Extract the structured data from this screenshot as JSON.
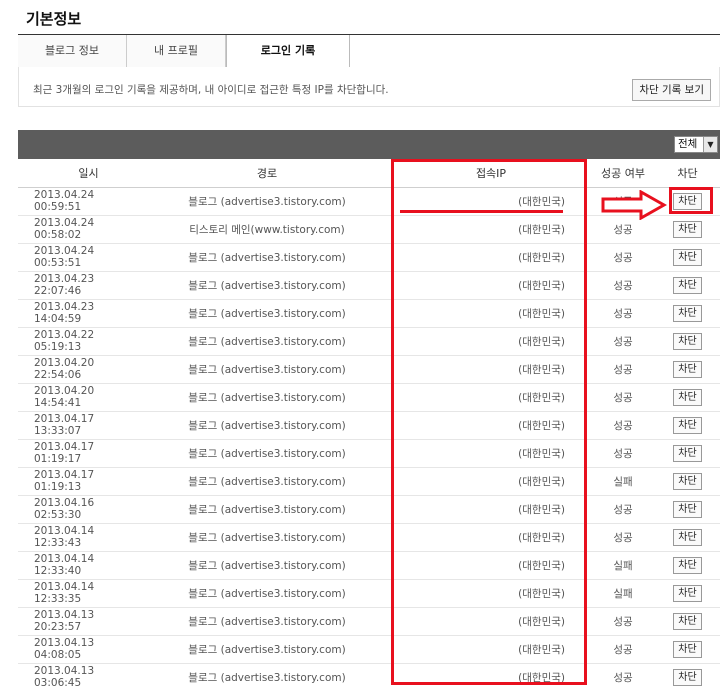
{
  "page": {
    "title": "기본정보"
  },
  "tabs": [
    {
      "label": "블로그 정보"
    },
    {
      "label": "내 프로필"
    },
    {
      "label": "로그인 기록"
    }
  ],
  "info": {
    "text": "최근 3개월의 로그인 기록을 제공하며, 내 아이디로 접근한 특정 IP를 차단합니다.",
    "block_history_button": "차단 기록 보기"
  },
  "filter": {
    "selected": "전체"
  },
  "table": {
    "headers": {
      "date": "일시",
      "path": "경로",
      "ip": "접속IP",
      "result": "성공 여부",
      "block": "차단"
    },
    "rows": [
      {
        "date": "2013.04.24 00:59:51",
        "path": "블로그 (advertise3.tistory.com)",
        "ip": "(대한민국)",
        "result": "성공",
        "block": "차단"
      },
      {
        "date": "2013.04.24 00:58:02",
        "path": "티스토리 메인(www.tistory.com)",
        "ip": "(대한민국)",
        "result": "성공",
        "block": "차단"
      },
      {
        "date": "2013.04.24 00:53:51",
        "path": "블로그 (advertise3.tistory.com)",
        "ip": "(대한민국)",
        "result": "성공",
        "block": "차단"
      },
      {
        "date": "2013.04.23 22:07:46",
        "path": "블로그 (advertise3.tistory.com)",
        "ip": "(대한민국)",
        "result": "성공",
        "block": "차단"
      },
      {
        "date": "2013.04.23 14:04:59",
        "path": "블로그 (advertise3.tistory.com)",
        "ip": "(대한민국)",
        "result": "성공",
        "block": "차단"
      },
      {
        "date": "2013.04.22 05:19:13",
        "path": "블로그 (advertise3.tistory.com)",
        "ip": "(대한민국)",
        "result": "성공",
        "block": "차단"
      },
      {
        "date": "2013.04.20 22:54:06",
        "path": "블로그 (advertise3.tistory.com)",
        "ip": "(대한민국)",
        "result": "성공",
        "block": "차단"
      },
      {
        "date": "2013.04.20 14:54:41",
        "path": "블로그 (advertise3.tistory.com)",
        "ip": "(대한민국)",
        "result": "성공",
        "block": "차단"
      },
      {
        "date": "2013.04.17 13:33:07",
        "path": "블로그 (advertise3.tistory.com)",
        "ip": "(대한민국)",
        "result": "성공",
        "block": "차단"
      },
      {
        "date": "2013.04.17 01:19:17",
        "path": "블로그 (advertise3.tistory.com)",
        "ip": "(대한민국)",
        "result": "성공",
        "block": "차단"
      },
      {
        "date": "2013.04.17 01:19:13",
        "path": "블로그 (advertise3.tistory.com)",
        "ip": "(대한민국)",
        "result": "실패",
        "block": "차단"
      },
      {
        "date": "2013.04.16 02:53:30",
        "path": "블로그 (advertise3.tistory.com)",
        "ip": "(대한민국)",
        "result": "성공",
        "block": "차단"
      },
      {
        "date": "2013.04.14 12:33:43",
        "path": "블로그 (advertise3.tistory.com)",
        "ip": "(대한민국)",
        "result": "성공",
        "block": "차단"
      },
      {
        "date": "2013.04.14 12:33:40",
        "path": "블로그 (advertise3.tistory.com)",
        "ip": "(대한민국)",
        "result": "실패",
        "block": "차단"
      },
      {
        "date": "2013.04.14 12:33:35",
        "path": "블로그 (advertise3.tistory.com)",
        "ip": "(대한민국)",
        "result": "실패",
        "block": "차단"
      },
      {
        "date": "2013.04.13 20:23:57",
        "path": "블로그 (advertise3.tistory.com)",
        "ip": "(대한민국)",
        "result": "성공",
        "block": "차단"
      },
      {
        "date": "2013.04.13 04:08:05",
        "path": "블로그 (advertise3.tistory.com)",
        "ip": "(대한민국)",
        "result": "성공",
        "block": "차단"
      },
      {
        "date": "2013.04.13 03:06:45",
        "path": "블로그 (advertise3.tistory.com)",
        "ip": "(대한민국)",
        "result": "성공",
        "block": "차단"
      }
    ]
  },
  "annotation_color": "#e8101e"
}
